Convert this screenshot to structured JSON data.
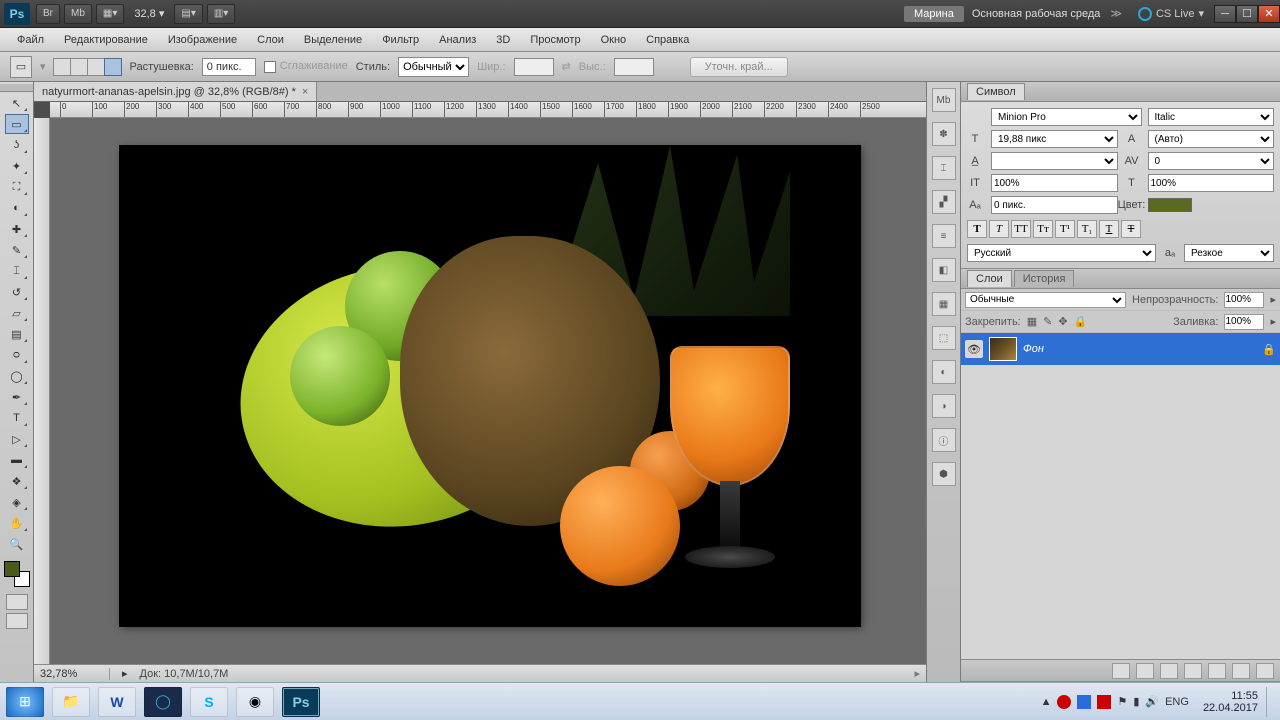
{
  "topbar": {
    "logo": "Ps",
    "btn_br": "Br",
    "btn_mb": "Mb",
    "zoom_label": "32,8",
    "user": "Марина",
    "workspace": "Основная рабочая среда",
    "cslive": "CS Live"
  },
  "menu": [
    "Файл",
    "Редактирование",
    "Изображение",
    "Слои",
    "Выделение",
    "Фильтр",
    "Анализ",
    "3D",
    "Просмотр",
    "Окно",
    "Справка"
  ],
  "options": {
    "feather_label": "Растушевка:",
    "feather_value": "0 пикс.",
    "antialias": "Сглаживание",
    "style_label": "Стиль:",
    "style_value": "Обычный",
    "width_label": "Шир.:",
    "height_label": "Выс.:",
    "refine": "Уточн. край..."
  },
  "doc": {
    "tab": "natyurmort-ananas-apelsin.jpg @ 32,8% (RGB/8#) *",
    "status_zoom": "32,78%",
    "status_doc": "Док: 10,7M/10,7M"
  },
  "ruler_ticks": [
    0,
    100,
    200,
    300,
    400,
    500,
    600,
    700,
    800,
    900,
    1000,
    1100,
    1200,
    1300,
    1400,
    1500,
    1600,
    1700,
    1800,
    1900,
    2000,
    2100,
    2200,
    2300,
    2400,
    2500
  ],
  "character": {
    "title": "Символ",
    "font": "Minion Pro",
    "style": "Italic",
    "size": "19,88 пикс",
    "leading": "(Авто)",
    "kerning": "",
    "tracking": "0",
    "vscale": "100%",
    "hscale": "100%",
    "baseline": "0 пикс.",
    "color_label": "Цвет:",
    "language": "Русский",
    "aa": "Резкое"
  },
  "layers": {
    "tab1": "Слои",
    "tab2": "История",
    "blend": "Обычные",
    "opacity_label": "Непрозрачность:",
    "opacity": "100%",
    "lock_label": "Закрепить:",
    "fill_label": "Заливка:",
    "fill": "100%",
    "layer_name": "Фон"
  },
  "taskbar": {
    "lang": "ENG",
    "time": "11:55",
    "date": "22.04.2017"
  }
}
